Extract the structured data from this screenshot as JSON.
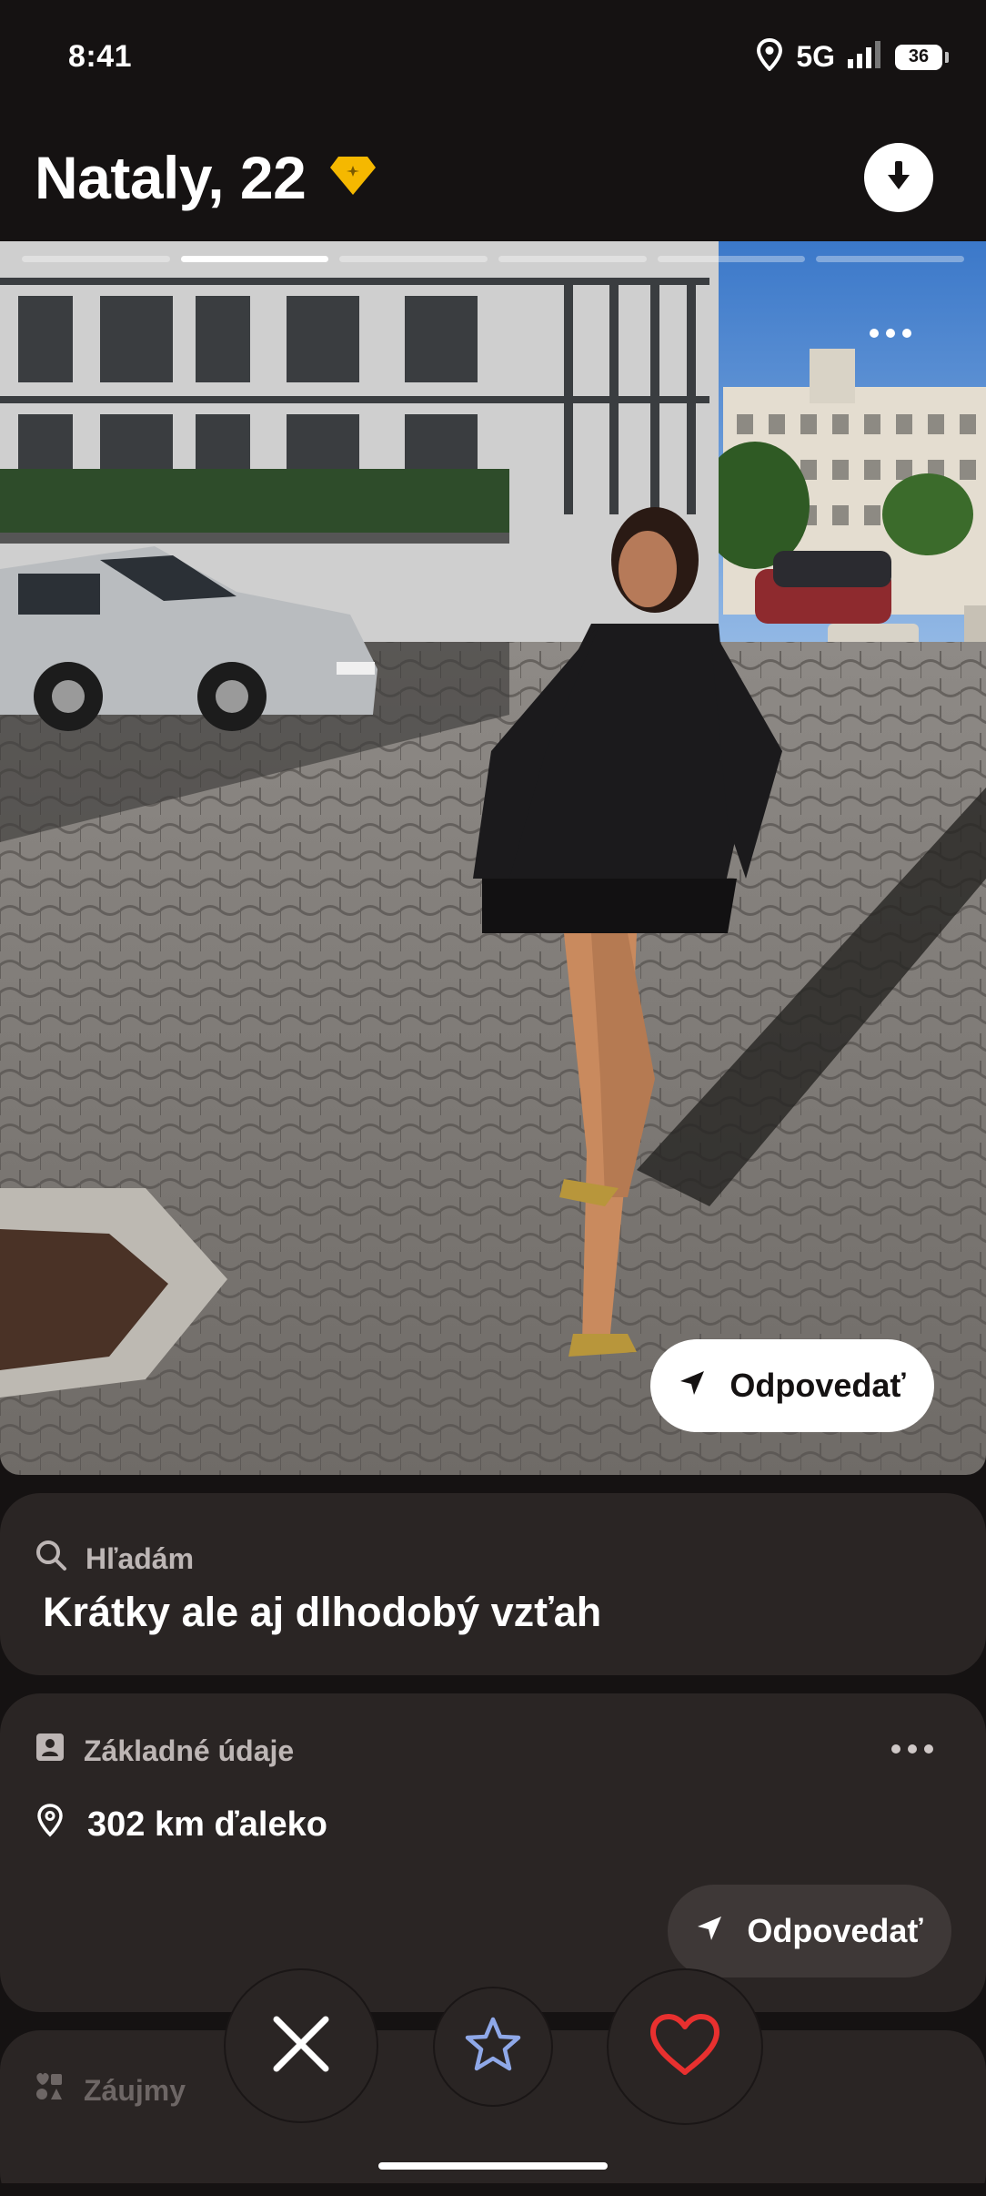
{
  "status_bar": {
    "time": "8:41",
    "network": "5G",
    "battery": "36"
  },
  "header": {
    "name_age": "Nataly, 22",
    "badge_color": "#F5B800"
  },
  "photo": {
    "progress_total": 6,
    "progress_active_index": 1,
    "reply_label": "Odpovedať"
  },
  "looking_for": {
    "label": "Hľadám",
    "value": "Krátky ale aj dlhodobý vzťah"
  },
  "basic_info": {
    "label": "Základné údaje",
    "distance": "302 km ďaleko",
    "reply_label": "Odpovedať"
  },
  "interests": {
    "label": "Záujmy"
  },
  "actions": {
    "pass_icon": "close-icon",
    "superlike_icon": "star-icon",
    "like_icon": "heart-icon",
    "like_color": "#E8302F",
    "star_color": "#8FA8E8"
  }
}
